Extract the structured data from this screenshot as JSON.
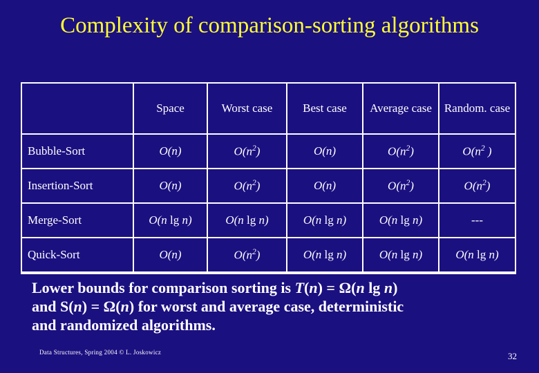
{
  "slide": {
    "title": "Complexity of comparison-sorting algorithms",
    "page_number": "32",
    "background_color": "#1b1080",
    "title_color": "#ffff33",
    "text_color": "#ffffff"
  },
  "table": {
    "headers": [
      "",
      "Space",
      "Worst case",
      "Best case",
      "Average case",
      "Random. case"
    ],
    "rows": [
      {
        "name": "Bubble-Sort",
        "cells": [
          "O(n)",
          "O(n2)",
          "O(n)",
          "O(n2)",
          "O(n2 )"
        ]
      },
      {
        "name": "Insertion-Sort",
        "cells": [
          "O(n)",
          "O(n2)",
          "O(n)",
          "O(n2)",
          "O(n2)"
        ]
      },
      {
        "name": "Merge-Sort",
        "cells": [
          "O(n lg n)",
          "O(n lg n)",
          "O(n lg n)",
          "O(n lg n)",
          "---"
        ]
      },
      {
        "name": "Quick-Sort",
        "cells": [
          "O(n)",
          "O(n2)",
          "O(n lg n)",
          "O(n lg n)",
          "O(n lg n)"
        ]
      }
    ]
  },
  "bounds_text": {
    "line1": "Lower bounds for comparison sorting is T(n) = Ω(n lg n)",
    "line2": "and S(n) = Ω(n) for worst and average case, deterministic",
    "line3": "and randomized algorithms."
  },
  "footer": {
    "credit": "Data Structures, Spring 2004 © L. Joskowicz"
  }
}
